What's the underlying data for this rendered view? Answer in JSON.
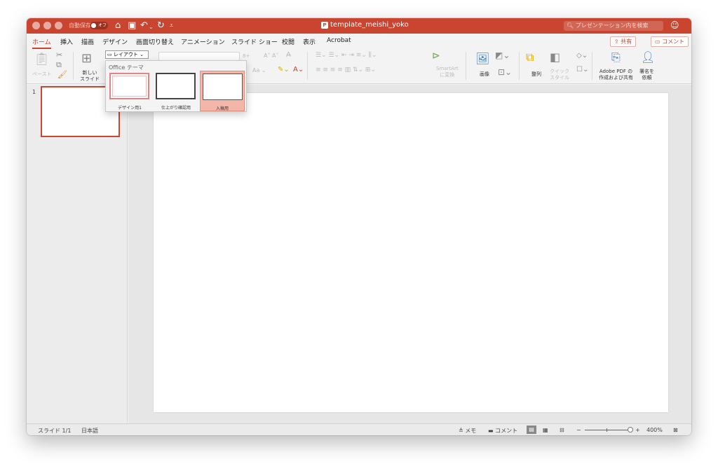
{
  "titlebar": {
    "autosave_label": "自動保存",
    "autosave_state": "オフ",
    "document_title": "template_meishi_yoko",
    "search_placeholder": "プレゼンテーション内を検索",
    "icons": [
      "home-icon",
      "save-icon",
      "undo-icon",
      "redo-icon",
      "customize-icon",
      "search-icon",
      "smiley-icon"
    ]
  },
  "tabs": [
    {
      "label": "ホーム",
      "active": true
    },
    {
      "label": "挿入"
    },
    {
      "label": "描画"
    },
    {
      "label": "デザイン"
    },
    {
      "label": "画面切り替え"
    },
    {
      "label": "アニメーション"
    },
    {
      "label": "スライド ショー"
    },
    {
      "label": "校閲"
    },
    {
      "label": "表示"
    },
    {
      "label": "Acrobat"
    }
  ],
  "actions": {
    "share_label": "共有",
    "comment_label": "コメント"
  },
  "ribbon": {
    "paste_label": "ペースト",
    "new_slide_label": "新しい\nスライド",
    "layout_label": "レイアウト",
    "font_size": "8+",
    "smartart_label": "SmartArt\nに変換",
    "image_label": "画像",
    "arrange_label": "整列",
    "quick_style_label": "クイック\nスタイル",
    "adobe_pdf_label": "Adobe PDF の\n作成および共有",
    "sign_label": "署名を\n依頼"
  },
  "layout_dropdown": {
    "title": "Office テーマ",
    "items": [
      {
        "label": "デザイン用1",
        "selected": false
      },
      {
        "label": "仕上がり確認用",
        "selected": false
      },
      {
        "label": "入稿用",
        "selected": true
      }
    ]
  },
  "slides_pane": {
    "slide_number": "1"
  },
  "statusbar": {
    "slide_info": "スライド 1/1",
    "language": "日本語",
    "notes_label": "メモ",
    "comments_label": "コメント",
    "zoom": "400%"
  },
  "colors": {
    "accent": "#c9452f",
    "selected_layout": "#f3b6a8"
  }
}
